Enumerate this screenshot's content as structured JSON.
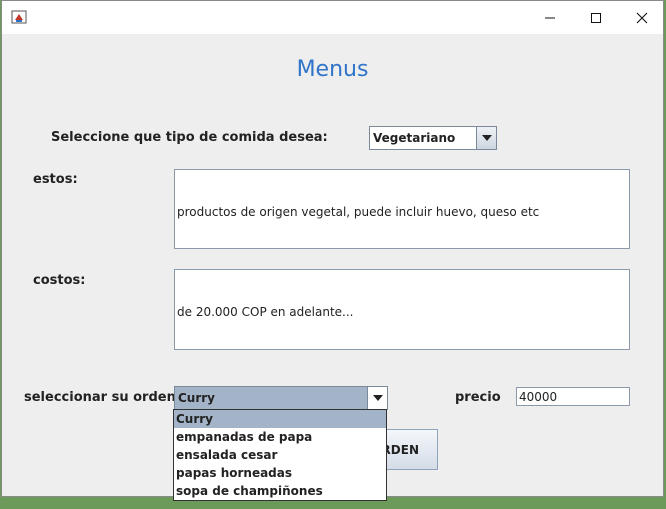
{
  "window": {
    "icon": "java-app-icon",
    "controls": [
      "minimize-icon",
      "maximize-icon",
      "close-icon"
    ]
  },
  "title": "Menus",
  "food_type": {
    "label": "Seleccione que tipo de comida desea:",
    "selected": "Vegetariano"
  },
  "description": {
    "label": "estos:",
    "text": "productos de origen vegetal, puede incluir huevo, queso etc"
  },
  "costs": {
    "label": "costos:",
    "text": "de 20.000 COP en adelante..."
  },
  "order": {
    "label": "seleccionar su orden",
    "selected": "Curry",
    "options": [
      "Curry",
      "empanadas de papa",
      "ensalada cesar",
      "papas horneadas",
      "sopa de champiñones"
    ]
  },
  "price": {
    "label": "precio",
    "value": "40000"
  },
  "order_button": {
    "visible_label": "RDEN"
  },
  "colors": {
    "title": "#2f74c9",
    "selection": "#a3b4c9",
    "window_bg": "#eeeeee"
  }
}
